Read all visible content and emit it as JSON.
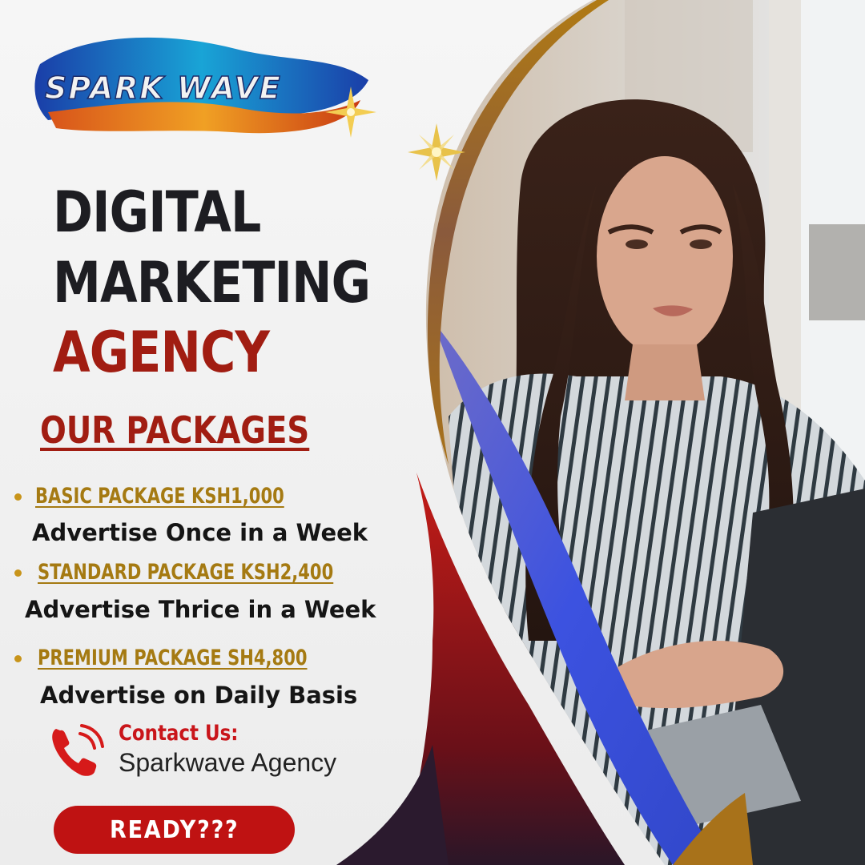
{
  "brand": {
    "logo_text": "SPARK WAVE"
  },
  "headline": {
    "line1": "DIGITAL",
    "line2": "MARKETING",
    "line3": "AGENCY"
  },
  "packages": {
    "title": "OUR PACKAGES",
    "items": [
      {
        "name": "BASIC PACKAGE KSH1,000",
        "description": "Advertise Once in a Week"
      },
      {
        "name": "STANDARD PACKAGE KSH2,400",
        "description": "Advertise Thrice in a Week"
      },
      {
        "name": "PREMIUM PACKAGE SH4,800",
        "description": "Advertise on Daily Basis"
      }
    ]
  },
  "contact": {
    "label": "Contact Us:",
    "name": "Sparkwave Agency",
    "icon": "phone-icon"
  },
  "cta": {
    "label": "READY???"
  },
  "colors": {
    "accent_red": "#a11d12",
    "gold": "#a57a12",
    "button_red": "#bf1212",
    "dark_text": "#1d1d22",
    "blue_swoosh": "#3c52d8"
  }
}
